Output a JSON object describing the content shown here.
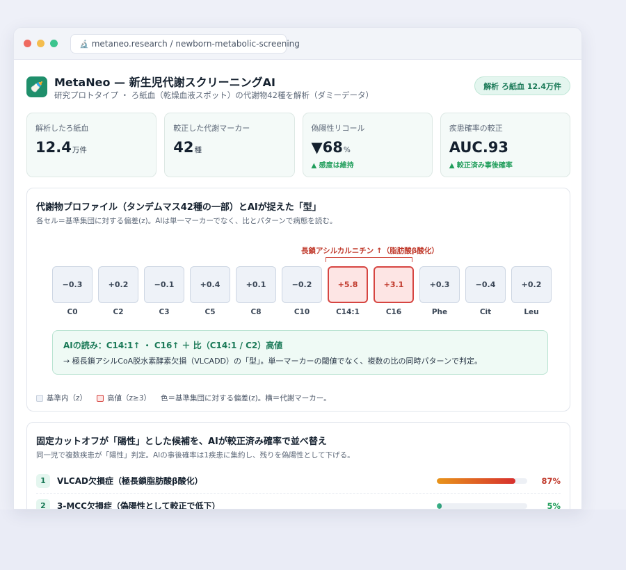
{
  "browser": {
    "url": "metaneo.research / newborn-metabolic-screening",
    "url_icon": "microscope-icon"
  },
  "app": {
    "icon": "baby-bottle-icon",
    "title": "MetaNeo — 新生児代謝スクリーニングAI",
    "subtitle": "研究プロトタイプ ・ ろ紙血（乾燥血液スポット）の代謝物42種を解析（ダミーデータ）",
    "badge": "解析 ろ紙血 12.4万件"
  },
  "stats": [
    {
      "label": "解析したろ紙血",
      "value": "12.4",
      "unit": "万件",
      "note": ""
    },
    {
      "label": "較正した代謝マーカー",
      "value": "42",
      "unit": "種",
      "note": ""
    },
    {
      "label": "偽陽性リコール",
      "value": "▼68",
      "unit": "%",
      "note": "▲ 感度は維持"
    },
    {
      "label": "疾患確率の較正",
      "value": "AUC.93",
      "unit": "",
      "note": "▲ 較正済み事後確率"
    }
  ],
  "profile": {
    "title": "代謝物プロファイル（タンデムマス42種の一部）とAIが捉えた「型」",
    "subtitle": "各セル＝基準集団に対する偏差(z)。AIは単一マーカーでなく、比とパターンで病態を読む。",
    "annotation": "長鎖アシルカルニチン ↑（脂肪酸β酸化）",
    "cells": [
      {
        "label": "C0",
        "z": "−0.3",
        "high": false
      },
      {
        "label": "C2",
        "z": "+0.2",
        "high": false
      },
      {
        "label": "C3",
        "z": "−0.1",
        "high": false
      },
      {
        "label": "C5",
        "z": "+0.4",
        "high": false
      },
      {
        "label": "C8",
        "z": "+0.1",
        "high": false
      },
      {
        "label": "C10",
        "z": "−0.2",
        "high": false
      },
      {
        "label": "C14:1",
        "z": "+5.8",
        "high": true
      },
      {
        "label": "C16",
        "z": "+3.1",
        "high": true
      },
      {
        "label": "Phe",
        "z": "+0.3",
        "high": false
      },
      {
        "label": "Cit",
        "z": "−0.4",
        "high": false
      },
      {
        "label": "Leu",
        "z": "+0.2",
        "high": false
      }
    ],
    "insight_title": "AIの読み：C14:1↑ ・ C16↑ ＋ 比（C14:1 / C2）高値",
    "insight_body": "→ 極長鎖アシルCoA脱水素酵素欠損（VLCADD）の「型」。単一マーカーの閾値でなく、複数の比の同時パターンで判定。",
    "legend": {
      "base": "基準内（z）",
      "high": "高値（z≥3）",
      "note": "色＝基準集団に対する偏差(z)。横＝代謝マーカー。"
    }
  },
  "ranking": {
    "title": "固定カットオフが「陽性」とした候補を、AIが較正済み確率で並べ替え",
    "subtitle": "同一児で複数疾患が「陽性」判定。AIの事後確率は1疾患に集約し、残りを偽陽性として下げる。",
    "rows": [
      {
        "rank": "1",
        "label": "VLCAD欠損症（極長鎖脂肪酸β酸化）",
        "value": 0.87,
        "pct": "87%",
        "level": "hot"
      },
      {
        "rank": "2",
        "label": "3-MCC欠損症（偽陽性として較正で低下）",
        "value": 0.05,
        "pct": "5%",
        "level": "cool"
      }
    ]
  }
}
